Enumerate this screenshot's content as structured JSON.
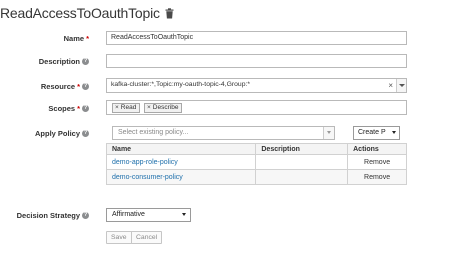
{
  "page": {
    "title": "ReadAccessToOauthTopic",
    "delete_icon": "trash-icon"
  },
  "form": {
    "name": {
      "label": "Name",
      "required": "*",
      "value": "ReadAccessToOauthTopic"
    },
    "description": {
      "label": "Description",
      "value": ""
    },
    "resource": {
      "label": "Resource",
      "required": "*",
      "value": "kafka-cluster:*,Topic:my-oauth-topic-4,Group:*",
      "clear": "×"
    },
    "scopes": {
      "label": "Scopes",
      "required": "*",
      "chips": [
        "Read",
        "Describe"
      ]
    },
    "apply_policy": {
      "label": "Apply Policy",
      "placeholder": "Select existing policy...",
      "create_label": "Create P",
      "columns": [
        "Name",
        "Description",
        "Actions"
      ],
      "rows": [
        {
          "name": "demo-app-role-policy",
          "description": "",
          "action": "Remove"
        },
        {
          "name": "demo-consumer-policy",
          "description": "",
          "action": "Remove"
        }
      ]
    },
    "decision_strategy": {
      "label": "Decision Strategy",
      "value": "Affirmative"
    },
    "buttons": {
      "save": "Save",
      "cancel": "Cancel"
    }
  },
  "help_icon_glyph": "?",
  "colors": {
    "link": "#1e6fab",
    "required": "#cc0000",
    "help_icon": "#8b8d8f"
  }
}
